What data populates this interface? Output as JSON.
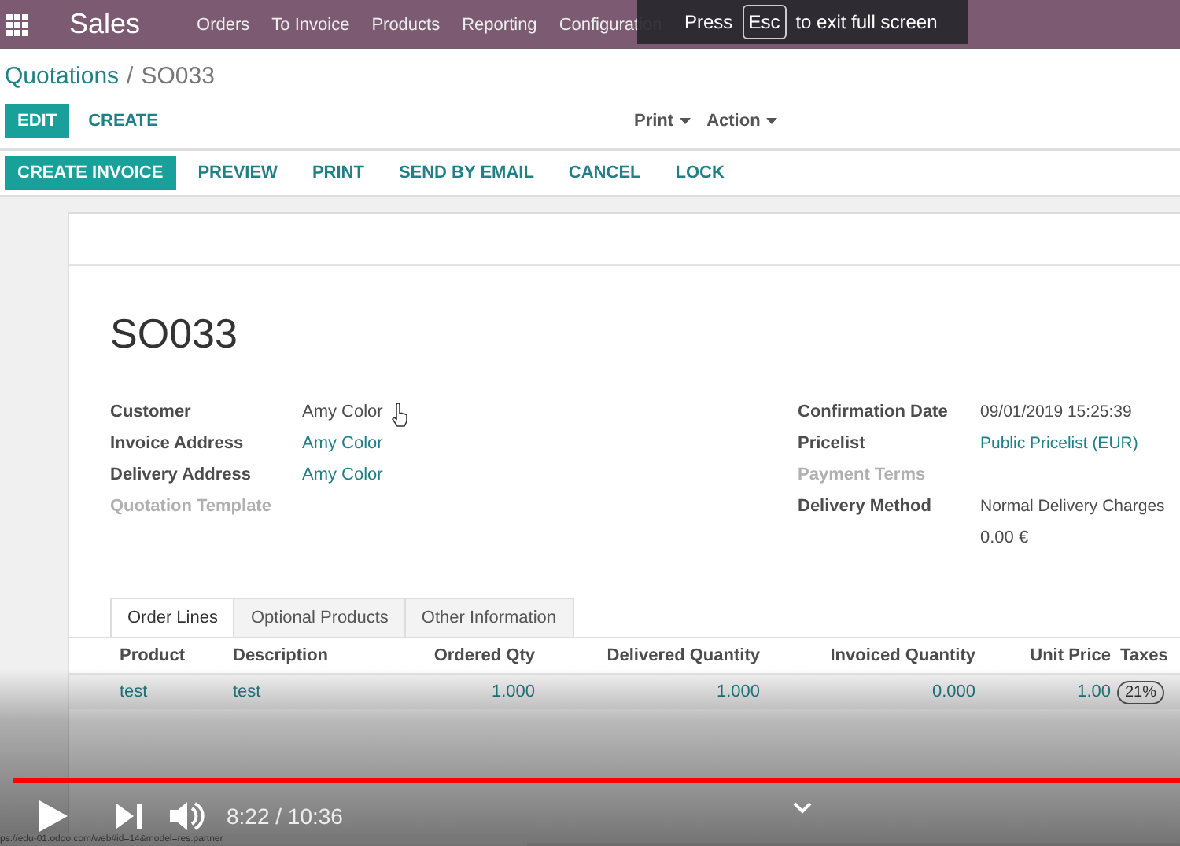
{
  "top_bar": {
    "app_name": "Sales",
    "menu": [
      "Orders",
      "To Invoice",
      "Products",
      "Reporting",
      "Configuration"
    ]
  },
  "fullscreen_hint": {
    "before": "Press",
    "key": "Esc",
    "after": "to exit full screen"
  },
  "breadcrumb": {
    "parent": "Quotations",
    "separator": "/",
    "current": "SO033"
  },
  "actions": {
    "buttons": [
      {
        "label": "EDIT",
        "primary": true
      },
      {
        "label": "CREATE",
        "primary": false
      }
    ],
    "dropdowns": [
      "Print",
      "Action"
    ]
  },
  "status_buttons": [
    {
      "label": "CREATE INVOICE",
      "primary": true
    },
    {
      "label": "PREVIEW",
      "primary": false
    },
    {
      "label": "PRINT",
      "primary": false
    },
    {
      "label": "SEND BY EMAIL",
      "primary": false
    },
    {
      "label": "CANCEL",
      "primary": false
    },
    {
      "label": "LOCK",
      "primary": false
    }
  ],
  "sheet": {
    "title": "SO033",
    "left_fields": [
      {
        "label": "Customer",
        "value": "Amy Color",
        "link": false,
        "muted": false
      },
      {
        "label": "Invoice Address",
        "value": "Amy Color",
        "link": true,
        "muted": false
      },
      {
        "label": "Delivery Address",
        "value": "Amy Color",
        "link": true,
        "muted": false
      },
      {
        "label": "Quotation Template",
        "muted": true
      }
    ],
    "right_fields": [
      {
        "label": "Confirmation Date",
        "value": "09/01/2019 15:25:39",
        "link": false,
        "muted": false
      },
      {
        "label": "Pricelist",
        "value": "Public Pricelist (EUR)",
        "link": true,
        "muted": false
      },
      {
        "label": "Payment Terms",
        "muted": true
      },
      {
        "label": "Delivery Method",
        "value": "Normal Delivery Charges",
        "note": "0.00 €",
        "link": false,
        "muted": false
      }
    ],
    "tabs": [
      {
        "label": "Order Lines",
        "selected": true
      },
      {
        "label": "Optional Products",
        "selected": false
      },
      {
        "label": "Other Information",
        "selected": false
      }
    ],
    "table": {
      "columns": [
        "Product",
        "Description",
        "Ordered Qty",
        "Delivered Quantity",
        "Invoiced Quantity",
        "Unit Price",
        "Taxes"
      ],
      "rows": [
        {
          "product": "test",
          "description": "test",
          "ordered_qty": "1.000",
          "delivered_quantity": "1.000",
          "invoiced_quantity": "0.000",
          "unit_price": "1.00",
          "taxes": "21%"
        }
      ]
    }
  },
  "video_player": {
    "progress": {
      "level": 1
    },
    "time": "8:22 / 10:36",
    "status_url": "ps://edu-01.odoo.com/web#id=14&model=res.partner"
  }
}
